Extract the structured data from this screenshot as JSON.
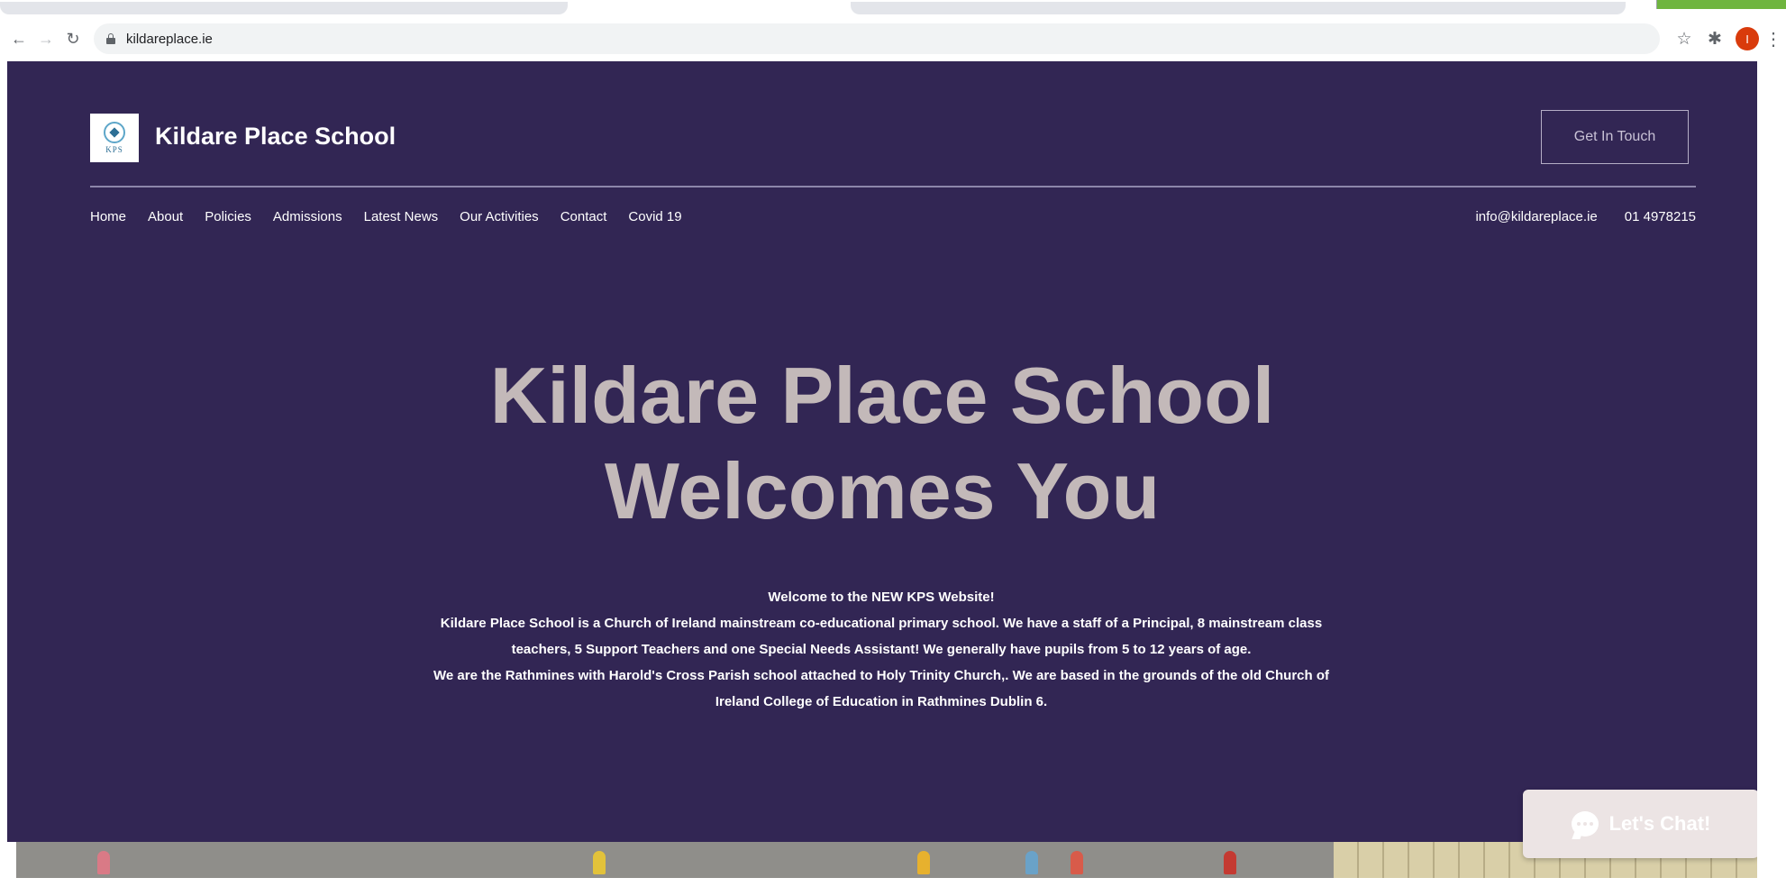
{
  "browser": {
    "url": "kildareplace.ie",
    "avatar_initial": "I",
    "icons": {
      "back": "arrow-left-icon",
      "forward": "arrow-right-icon",
      "reload": "reload-icon",
      "lock": "lock-icon",
      "bookmark": "star-icon",
      "extensions": "puzzle-icon",
      "menu": "kebab-menu-icon"
    }
  },
  "header": {
    "logo_text": "KPS",
    "brand": "Kildare Place School",
    "cta_label": "Get In Touch",
    "nav": [
      "Home",
      "About",
      "Policies",
      "Admissions",
      "Latest News",
      "Our Activities",
      "Contact",
      "Covid 19"
    ],
    "email": "info@kildareplace.ie",
    "phone": "01 4978215"
  },
  "hero": {
    "headline_line1": "Kildare Place School",
    "headline_line2": "Welcomes You",
    "intro_lines": [
      "Welcome to the NEW KPS Website!",
      "Kildare Place School is a Church of Ireland mainstream co-educational primary school. We have a staff of a Principal, 8 mainstream class teachers, 5 Support Teachers and one Special Needs Assistant! We generally have pupils from 5 to 12 years of age.",
      "We are the Rathmines with Harold's Cross Parish school attached to Holy Trinity Church,. We are based in the grounds of the old Church of Ireland College of Education in Rathmines Dublin 6."
    ]
  },
  "chat": {
    "label": "Let's Chat!"
  },
  "colors": {
    "hero_bg": "#322654",
    "headline": "#c3b9b9",
    "chat_bg": "#ece4e4",
    "corner_tab": "#6fb53f",
    "avatar": "#d93b0c"
  }
}
